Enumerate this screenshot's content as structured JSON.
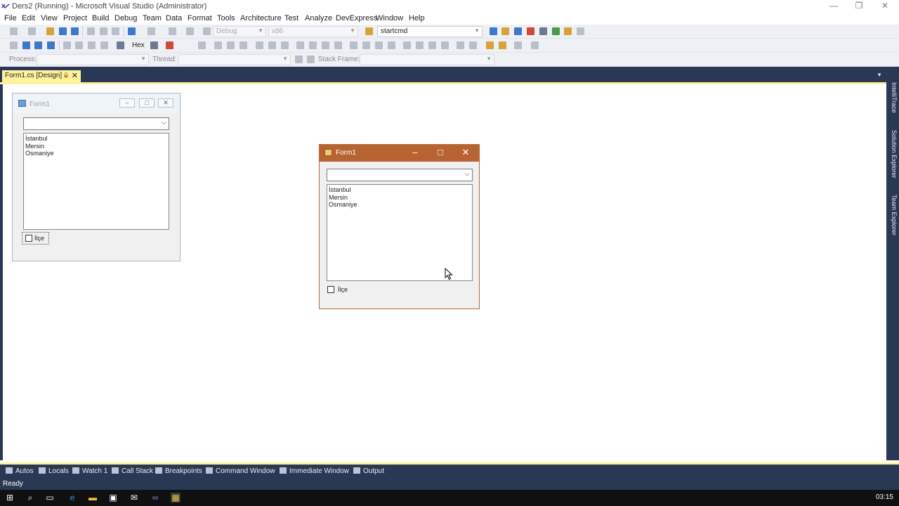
{
  "window": {
    "title": "Ders2 (Running) - Microsoft Visual Studio (Administrator)",
    "minimize": "—",
    "restore": "❐",
    "close": "✕"
  },
  "menu": [
    "File",
    "Edit",
    "View",
    "Project",
    "Build",
    "Debug",
    "Team",
    "Data",
    "Format",
    "Tools",
    "Architecture",
    "Test",
    "Analyze",
    "DevExpress",
    "Window",
    "Help"
  ],
  "toolbar": {
    "config": "Debug",
    "platform": "x86",
    "find": "startcmd",
    "hex": "Hex"
  },
  "debug_location": {
    "process_label": "Process:",
    "thread_label": "Thread:",
    "stack_frame_label": "Stack Frame:"
  },
  "document_tab": {
    "label": "Form1.cs [Design]",
    "close": "✕"
  },
  "side_panels": [
    "IntelliTrace",
    "Solution Explorer",
    "Team Explorer"
  ],
  "design_form": {
    "title": "Form1",
    "list_items": [
      "İstanbul",
      "Mersin",
      "Osmaniye"
    ],
    "checkbox_label": "İlçe"
  },
  "running_form": {
    "title": "Form1",
    "list_items": [
      "İstanbul",
      "Mersin",
      "Osmaniye"
    ],
    "checkbox_label": "İlçe"
  },
  "tool_tabs": [
    "Autos",
    "Locals",
    "Watch 1",
    "Call Stack",
    "Breakpoints",
    "Command Window",
    "Immediate Window",
    "Output"
  ],
  "status": "Ready",
  "clock": "03:15",
  "colors": {
    "vs_dark": "#293955",
    "tab_gold": "#fff29d",
    "running_caption": "#b86432"
  }
}
